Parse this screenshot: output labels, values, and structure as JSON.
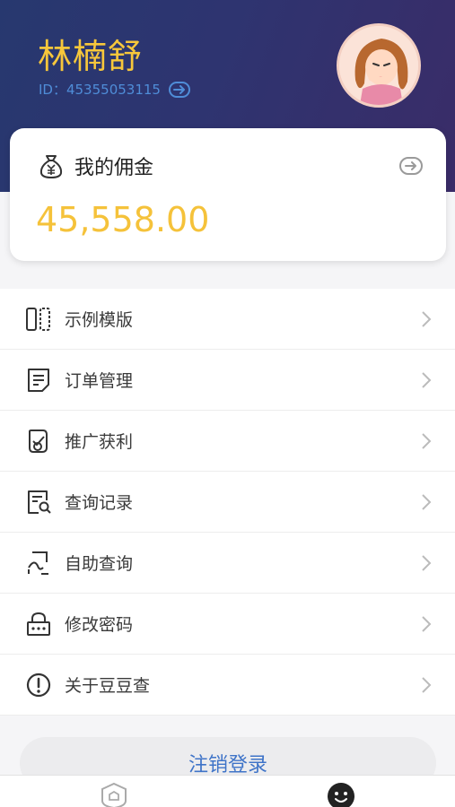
{
  "user": {
    "name": "林楠舒",
    "id_text": "ID：45355053115",
    "avatar": "cartoon-girl-avatar"
  },
  "commission": {
    "title": "我的佣金",
    "amount": "45,558.00",
    "icon": "money-bag-icon"
  },
  "menu": [
    {
      "label": "示例模版",
      "icon": "template-icon"
    },
    {
      "label": "订单管理",
      "icon": "order-list-icon"
    },
    {
      "label": "推广获利",
      "icon": "promote-icon"
    },
    {
      "label": "查询记录",
      "icon": "search-record-icon"
    },
    {
      "label": "自助查询",
      "icon": "self-query-icon"
    },
    {
      "label": "修改密码",
      "icon": "lock-icon"
    },
    {
      "label": "关于豆豆查",
      "icon": "info-icon"
    }
  ],
  "logout_label": "注销登录",
  "tabs": [
    {
      "icon": "home-shield-icon",
      "active": false
    },
    {
      "icon": "profile-face-icon",
      "active": true
    }
  ],
  "colors": {
    "header_start": "#27386f",
    "header_end": "#3a2c68",
    "accent_yellow": "#f5c23a",
    "id_blue": "#4f8dd8",
    "logout_blue": "#3f74c8"
  }
}
